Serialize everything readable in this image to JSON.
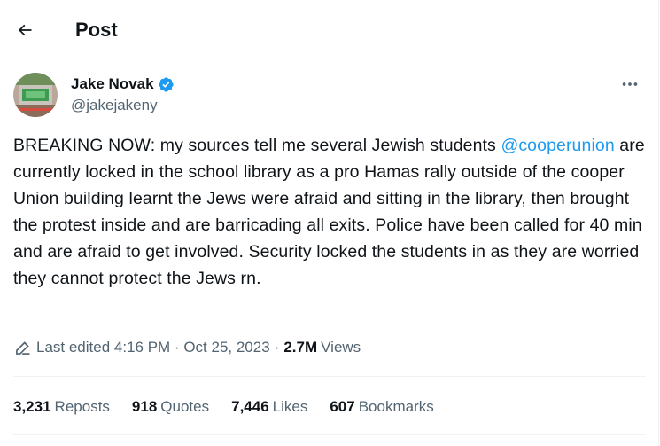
{
  "header": {
    "title": "Post"
  },
  "author": {
    "name": "Jake Novak",
    "handle": "@jakejakeny"
  },
  "tweet": {
    "text_before": "BREAKING NOW: my sources tell me several Jewish students ",
    "mention": "@cooperunion",
    "text_after": " are currently locked in the school library as a pro Hamas rally outside of the cooper Union building learnt the Jews were afraid and sitting in the library, then brought the protest inside and are barricading all exits. Police have been called for 40 min and are afraid to get involved. Security locked the students in as they are worried they cannot protect the Jews rn."
  },
  "meta": {
    "edited_label": "Last edited 4:16 PM · Oct 25, 2023",
    "separator": "·",
    "views_count": "2.7M",
    "views_label": "Views"
  },
  "stats": [
    {
      "count": "3,231",
      "label": "Reposts"
    },
    {
      "count": "918",
      "label": "Quotes"
    },
    {
      "count": "7,446",
      "label": "Likes"
    },
    {
      "count": "607",
      "label": "Bookmarks"
    }
  ],
  "icons": {
    "back": "arrow-left-icon",
    "verified": "verified-badge-icon",
    "more": "more-horizontal-icon",
    "edit": "pencil-icon"
  },
  "colors": {
    "accent": "#1d9bf0",
    "secondary_text": "#536471",
    "primary_text": "#0f1419"
  }
}
